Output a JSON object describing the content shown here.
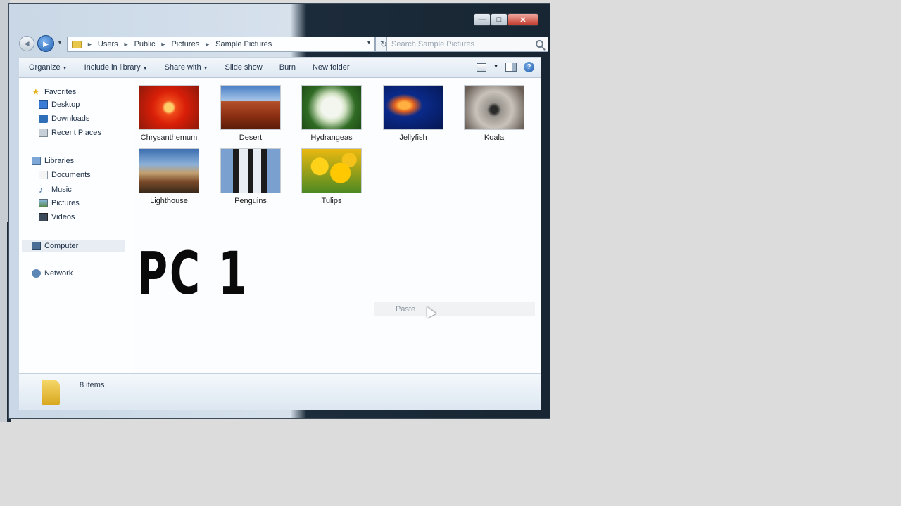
{
  "window": {
    "title_controls": {
      "minimize": "—",
      "maximize": "□",
      "close": "✕"
    }
  },
  "address": {
    "back": "◄",
    "forward": "►",
    "breadcrumbs": [
      "Users",
      "Public",
      "Pictures",
      "Sample Pictures"
    ],
    "separator": "►",
    "refresh": "↻",
    "search_placeholder": "Search Sample Pictures"
  },
  "toolbar": {
    "organize": "Organize",
    "include": "Include in library",
    "share": "Share with",
    "slideshow": "Slide show",
    "burn": "Burn",
    "new_folder": "New folder",
    "help": "?"
  },
  "navpane": {
    "favorites": "Favorites",
    "desktop": "Desktop",
    "downloads": "Downloads",
    "recent": "Recent Places",
    "libraries": "Libraries",
    "documents": "Documents",
    "music": "Music",
    "pictures": "Pictures",
    "videos": "Videos",
    "computer": "Computer",
    "network": "Network"
  },
  "files": [
    {
      "name": "Chrysanthemum",
      "thumb": "img-chrys"
    },
    {
      "name": "Desert",
      "thumb": "img-desert"
    },
    {
      "name": "Hydrangeas",
      "thumb": "img-hydr"
    },
    {
      "name": "Jellyfish",
      "thumb": "img-jelly"
    },
    {
      "name": "Koala",
      "thumb": "img-koala"
    },
    {
      "name": "Lighthouse",
      "thumb": "img-light"
    },
    {
      "name": "Penguins",
      "thumb": "img-peng"
    },
    {
      "name": "Tulips",
      "thumb": "img-tulips"
    }
  ],
  "overlay_text": "PC 1",
  "context_menu": {
    "paste": "Paste"
  },
  "details": {
    "item_count": "8 items"
  }
}
